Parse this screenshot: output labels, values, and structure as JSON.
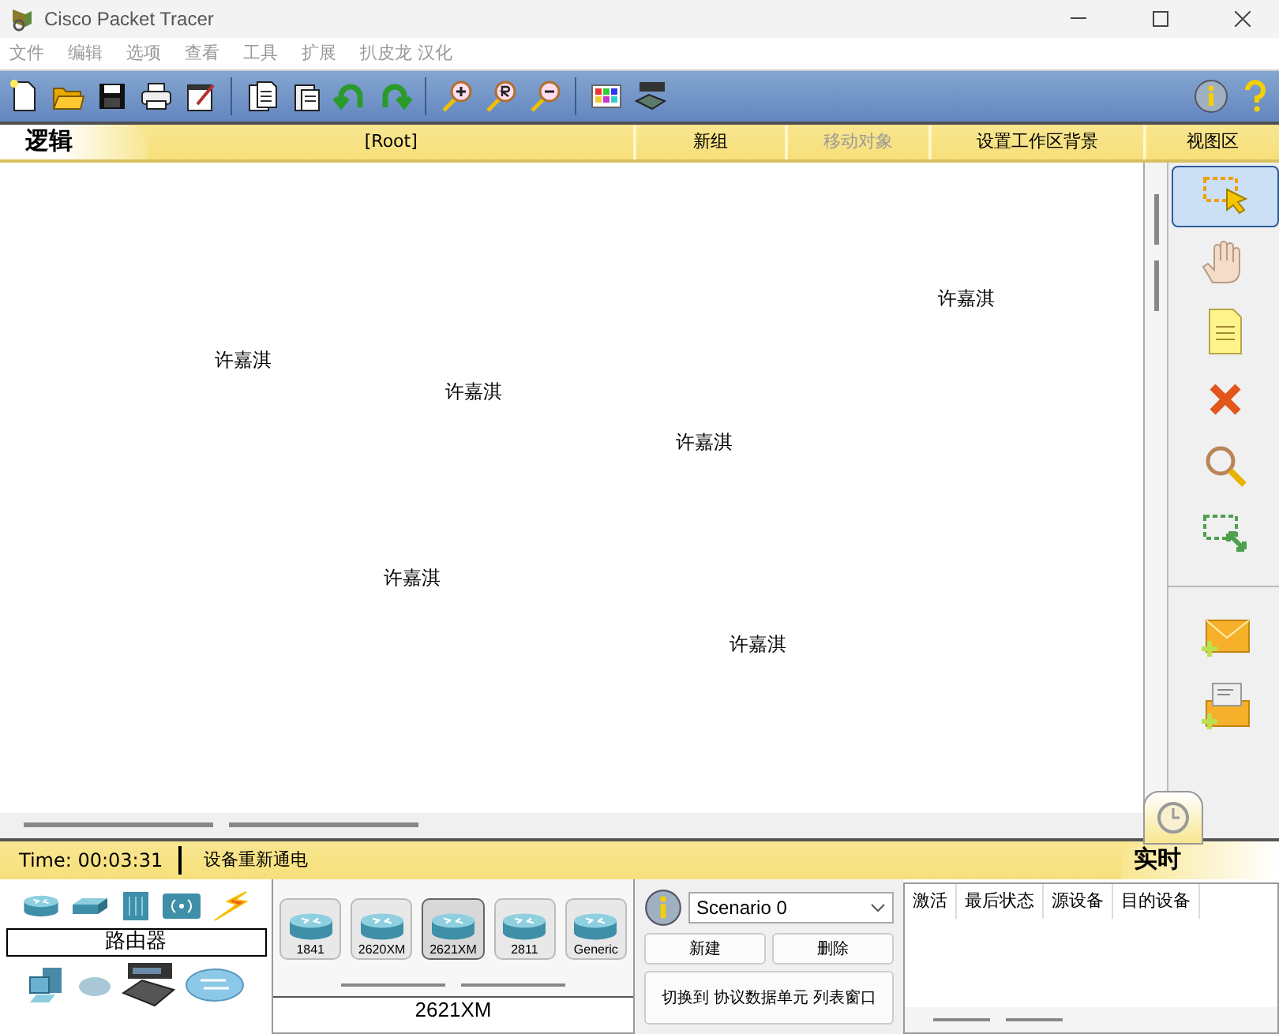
{
  "window": {
    "title": "Cisco Packet Tracer"
  },
  "menu": [
    "文件",
    "编辑",
    "选项",
    "查看",
    "工具",
    "扩展",
    "扒皮龙 汉化"
  ],
  "workspace_bar": {
    "mode_tab": "逻辑",
    "path": "[Root]",
    "actions": [
      {
        "label": "新组",
        "disabled": false
      },
      {
        "label": "移动对象",
        "disabled": true
      },
      {
        "label": "设置工作区背景",
        "disabled": false
      },
      {
        "label": "视图区",
        "disabled": false
      }
    ]
  },
  "canvas": {
    "labels": [
      "许嘉淇",
      "许嘉淇",
      "许嘉淇",
      "许嘉淇",
      "许嘉淇",
      "许嘉淇"
    ]
  },
  "tools": [
    {
      "kind": "select",
      "selected": true
    },
    {
      "kind": "move",
      "selected": false
    },
    {
      "kind": "note",
      "selected": false
    },
    {
      "kind": "delete",
      "selected": false
    },
    {
      "kind": "inspect",
      "selected": false
    },
    {
      "kind": "resize",
      "selected": false
    },
    {
      "kind": "simple-pdu",
      "selected": false
    },
    {
      "kind": "complex-pdu",
      "selected": false
    }
  ],
  "status_bar": {
    "time": "Time: 00:03:31",
    "message": "设备重新通电",
    "mode_tab": "实时"
  },
  "device_panel": {
    "category": "路由器",
    "models": [
      {
        "name": "1841",
        "selected": false
      },
      {
        "name": "2620XM",
        "selected": false
      },
      {
        "name": "2621XM",
        "selected": true
      },
      {
        "name": "2811",
        "selected": false
      },
      {
        "name": "Generic",
        "selected": false
      }
    ],
    "selected_model": "2621XM"
  },
  "scenario": {
    "value": "Scenario 0",
    "buttons": [
      "新建",
      "删除",
      "切换到 协议数据单元 列表窗口"
    ]
  },
  "pdu_table": {
    "columns": [
      "激活",
      "最后状态",
      "源设备",
      "目的设备"
    ]
  }
}
